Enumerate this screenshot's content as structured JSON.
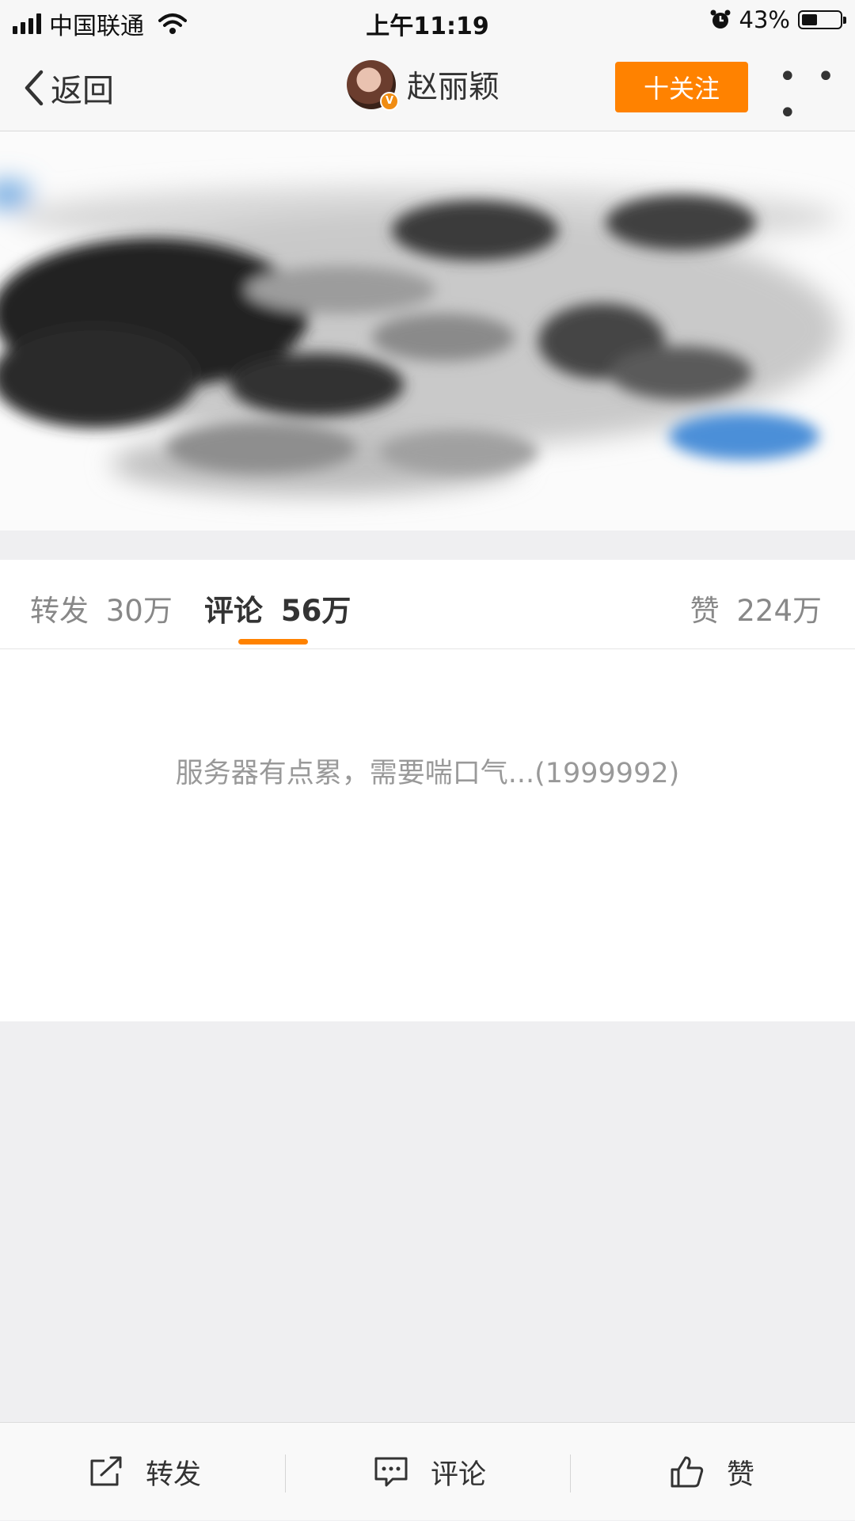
{
  "status_bar": {
    "carrier": "中国联通",
    "time": "上午11:19",
    "battery_percent": "43%",
    "battery_level": 0.43
  },
  "nav": {
    "back_label": "返回",
    "user_name": "赵丽颖",
    "verified_badge": "V",
    "follow_label": "十关注",
    "more_label": "• • •"
  },
  "tabs": {
    "repost_label": "转发",
    "repost_count": "30万",
    "comment_label": "评论",
    "comment_count": "56万",
    "like_label": "赞",
    "like_count": "224万"
  },
  "comments": {
    "error_message": "服务器有点累，需要喘口气...(1999992)"
  },
  "toolbar": {
    "repost_label": "转发",
    "comment_label": "评论",
    "like_label": "赞"
  },
  "colors": {
    "accent": "#ff8200",
    "page_bg": "#efeff1",
    "muted_text": "#999999"
  },
  "icons": {
    "back": "chevron-left-icon",
    "repost": "share-icon",
    "comment": "comment-icon",
    "like": "thumbs-up-icon",
    "alarm": "alarm-icon",
    "wifi": "wifi-icon"
  }
}
